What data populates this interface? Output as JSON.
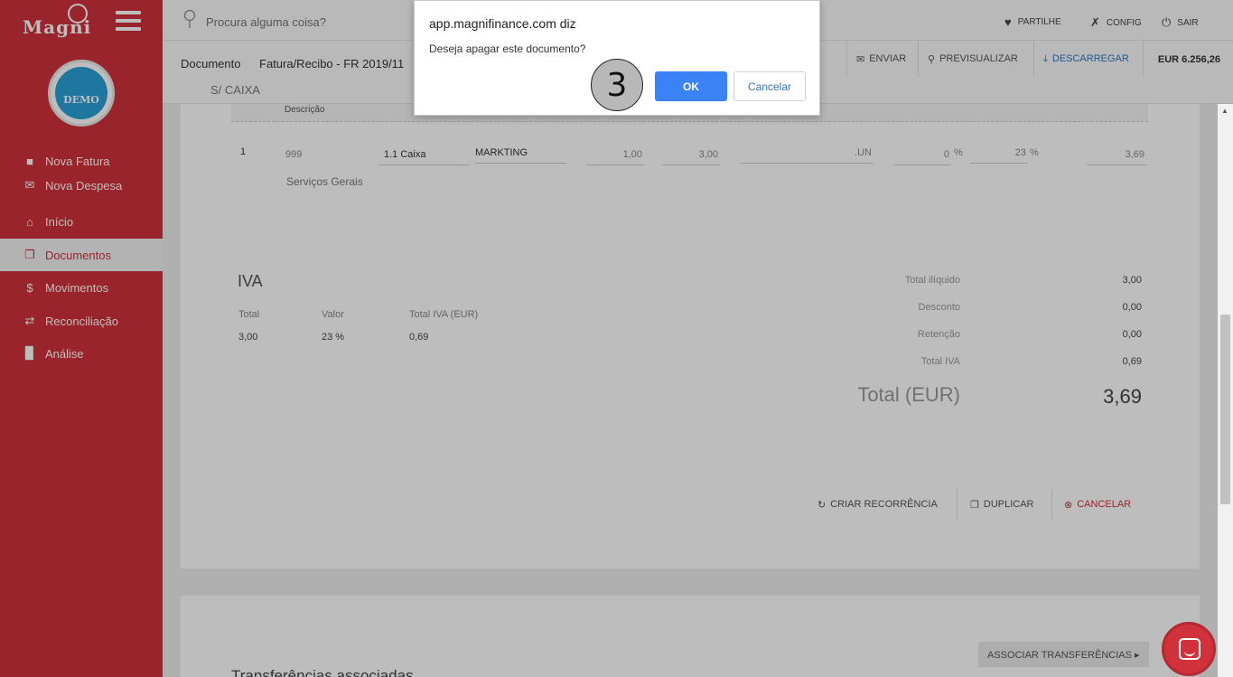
{
  "sidebar": {
    "brand": "Magni",
    "avatar_label": "DEMO",
    "items": [
      {
        "label": "Nova Fatura",
        "icon": "document-icon"
      },
      {
        "label": "Nova Despesa",
        "icon": "envelope-icon"
      },
      {
        "label": "Início",
        "icon": "home-icon"
      },
      {
        "label": "Documentos",
        "icon": "documents-icon"
      },
      {
        "label": "Movimentos",
        "icon": "dollar-icon"
      },
      {
        "label": "Reconciliação",
        "icon": "shuffle-icon"
      },
      {
        "label": "Análise",
        "icon": "chart-icon"
      }
    ],
    "active_index": 3
  },
  "topbar": {
    "search_placeholder": "Procura alguma coisa?",
    "share": "PARTILHE",
    "config": "CONFIG",
    "logout": "SAIR"
  },
  "header": {
    "doc_label": "Documento",
    "doc_title": "Fatura/Recibo - FR 2019/11",
    "doc_sub": "S/ CAIXA",
    "send": "ENVIAR",
    "preview": "PREVISUALIZAR",
    "download": "DESCARREGAR",
    "balance": "EUR 6.256,26"
  },
  "lines": {
    "header_label": "Descrição",
    "row": {
      "index": "1",
      "code": "999",
      "account": "1.1 Caixa",
      "category": "MARKTING",
      "quantity": "1,00",
      "price": "3,00",
      "unit": ".UN",
      "discount": "0",
      "discount_unit": "%",
      "vat": "23",
      "vat_unit": "%",
      "total": "3,69",
      "description": "Serviços Gerais"
    }
  },
  "iva": {
    "title": "IVA",
    "col_total": "Total",
    "col_valor": "Valor",
    "col_total_iva": "Total IVA (EUR)",
    "total": "3,00",
    "valor": "23 %",
    "total_iva": "0,69"
  },
  "totals": {
    "liquido_label": "Total ilíquido",
    "liquido": "3,00",
    "desconto_label": "Desconto",
    "desconto": "0,00",
    "retencao_label": "Retenção",
    "retencao": "0,00",
    "iva_label": "Total IVA",
    "iva": "0,69",
    "grand_label": "Total (EUR)",
    "grand": "3,69"
  },
  "actions": {
    "recurrence": "CRIAR RECORRÊNCIA",
    "duplicate": "DUPLICAR",
    "cancel": "CANCELAR"
  },
  "transfers": {
    "associate": "ASSOCIAR TRANSFERÊNCIAS ▸",
    "title": "Transferências associadas"
  },
  "dialog": {
    "title": "app.magnifinance.com diz",
    "message": "Deseja apagar este documento?",
    "ok": "OK",
    "cancel": "Cancelar"
  },
  "step_badge": "3",
  "colors": {
    "brand_red": "#d0313a",
    "link_blue": "#2d78c4",
    "ok_blue": "#3b82f6"
  }
}
